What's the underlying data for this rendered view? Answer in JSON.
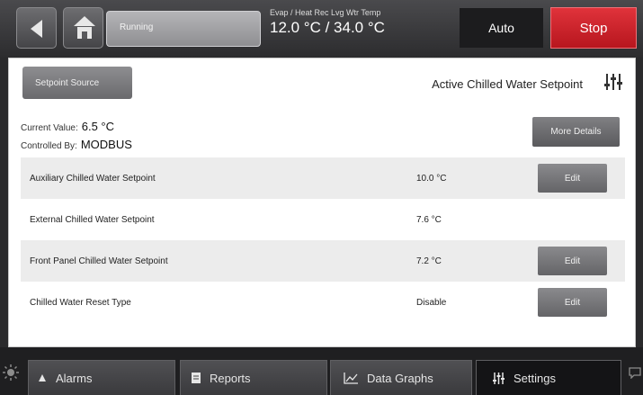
{
  "header": {
    "status": "Running",
    "temp_label": "Evap / Heat Rec Lvg Wtr Temp",
    "temp_value": "12.0 °C / 34.0 °C",
    "auto_label": "Auto",
    "stop_label": "Stop",
    "stop_color": "#d0222a"
  },
  "panel": {
    "source_button": "Setpoint Source",
    "title": "Active Chilled Water Setpoint",
    "current_value_label": "Current Value:",
    "current_value": "6.5 °C",
    "controlled_by_label": "Controlled By:",
    "controlled_by": "MODBUS",
    "more_details": "More Details",
    "rows": [
      {
        "name": "Auxiliary Chilled Water Setpoint",
        "value": "10.0 °C",
        "edit": "Edit"
      },
      {
        "name": "External Chilled Water Setpoint",
        "value": "7.6 °C",
        "edit": ""
      },
      {
        "name": "Front Panel Chilled Water Setpoint",
        "value": "7.2 °C",
        "edit": "Edit"
      },
      {
        "name": "Chilled Water Reset Type",
        "value": "Disable",
        "edit": "Edit"
      }
    ]
  },
  "footer": {
    "tabs": [
      {
        "label": "Alarms",
        "icon": "bell-icon"
      },
      {
        "label": "Reports",
        "icon": "report-icon"
      },
      {
        "label": "Data Graphs",
        "icon": "line-graph-icon"
      },
      {
        "label": "Settings",
        "icon": "sliders-icon"
      }
    ],
    "active_tab": "Settings"
  }
}
